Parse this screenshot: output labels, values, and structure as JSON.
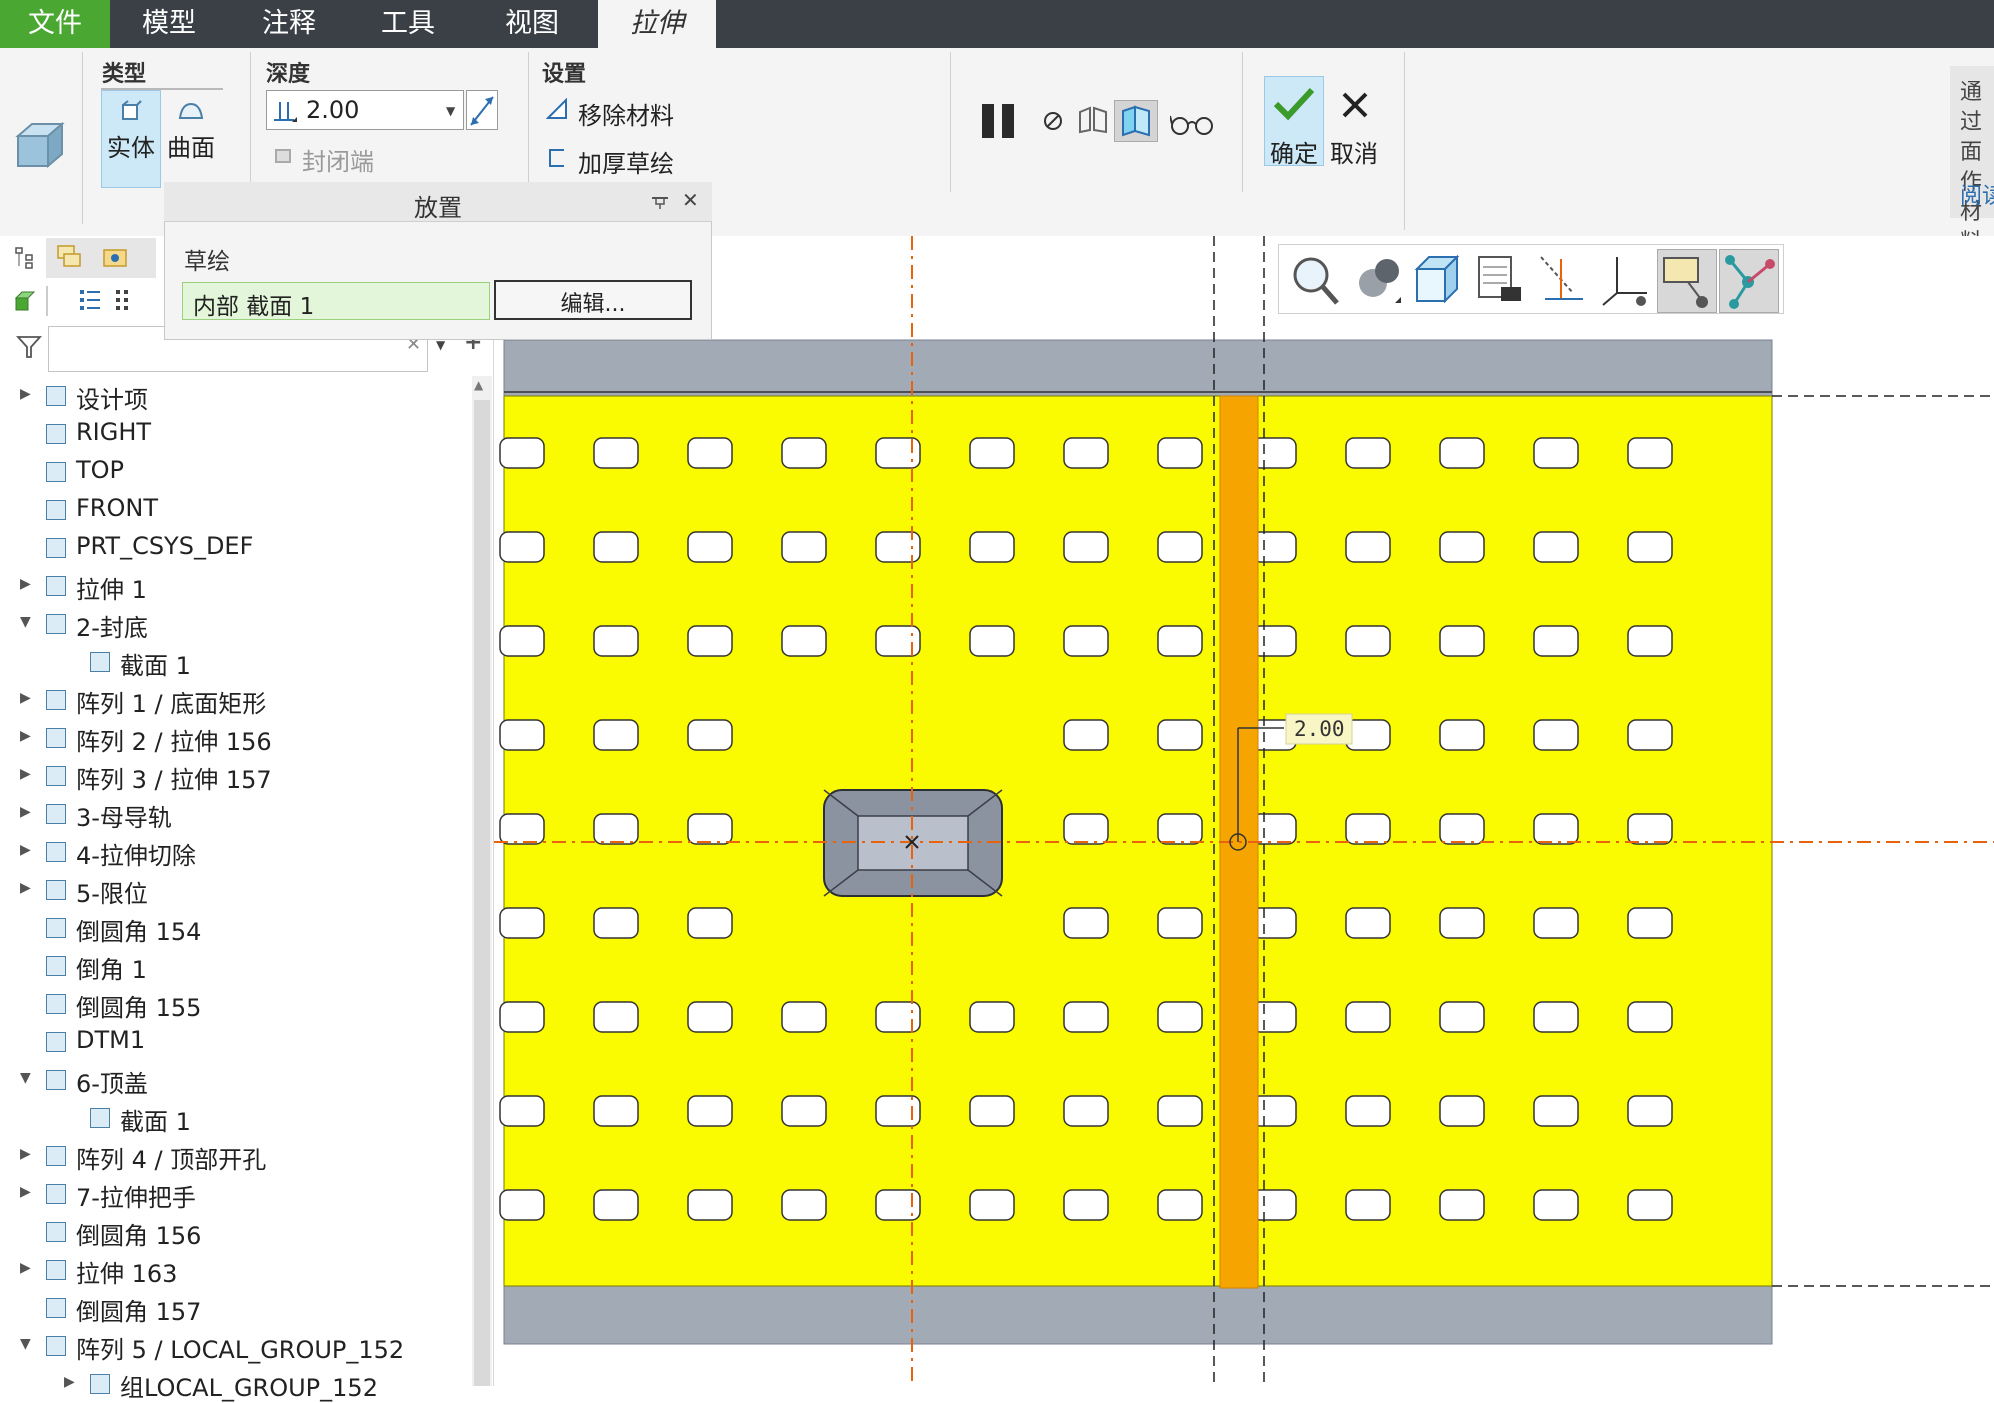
{
  "menu": {
    "tabs": [
      "文件",
      "模型",
      "注释",
      "工具",
      "视图",
      "拉伸"
    ]
  },
  "ribbon": {
    "type": {
      "title": "类型",
      "solid": "实体",
      "surface": "曲面"
    },
    "depth": {
      "title": "深度",
      "value": "2.00",
      "cap_ends": "封闭端"
    },
    "settings": {
      "title": "设置",
      "remove_material": "移除材料",
      "thicken_sketch": "加厚草绘"
    },
    "confirm": "确定",
    "cancel": "取消",
    "help_text": [
      "通过",
      "面作",
      "材料"
    ],
    "help_link": "阅读"
  },
  "placement": {
    "title": "放置",
    "sketch_label": "草绘",
    "section_value": "内部 截面 1",
    "edit_button": "编辑..."
  },
  "tree": {
    "items": [
      {
        "label": "设计项",
        "indent": 0,
        "expander": "▶"
      },
      {
        "label": "RIGHT",
        "indent": 0,
        "expander": ""
      },
      {
        "label": "TOP",
        "indent": 0,
        "expander": ""
      },
      {
        "label": "FRONT",
        "indent": 0,
        "expander": ""
      },
      {
        "label": "PRT_CSYS_DEF",
        "indent": 0,
        "expander": ""
      },
      {
        "label": "拉伸 1",
        "indent": 0,
        "expander": "▶"
      },
      {
        "label": "2-封底",
        "indent": 0,
        "expander": "▼"
      },
      {
        "label": "截面 1",
        "indent": 1,
        "expander": ""
      },
      {
        "label": "阵列 1 / 底面矩形",
        "indent": 0,
        "expander": "▶"
      },
      {
        "label": "阵列 2 / 拉伸 156",
        "indent": 0,
        "expander": "▶"
      },
      {
        "label": "阵列 3 / 拉伸 157",
        "indent": 0,
        "expander": "▶"
      },
      {
        "label": "3-母导轨",
        "indent": 0,
        "expander": "▶"
      },
      {
        "label": "4-拉伸切除",
        "indent": 0,
        "expander": "▶"
      },
      {
        "label": "5-限位",
        "indent": 0,
        "expander": "▶"
      },
      {
        "label": "倒圆角 154",
        "indent": 0,
        "expander": ""
      },
      {
        "label": "倒角 1",
        "indent": 0,
        "expander": ""
      },
      {
        "label": "倒圆角 155",
        "indent": 0,
        "expander": ""
      },
      {
        "label": "DTM1",
        "indent": 0,
        "expander": ""
      },
      {
        "label": "6-顶盖",
        "indent": 0,
        "expander": "▼"
      },
      {
        "label": "截面 1",
        "indent": 1,
        "expander": ""
      },
      {
        "label": "阵列 4 / 顶部开孔",
        "indent": 0,
        "expander": "▶"
      },
      {
        "label": "7-拉伸把手",
        "indent": 0,
        "expander": "▶"
      },
      {
        "label": "倒圆角 156",
        "indent": 0,
        "expander": ""
      },
      {
        "label": "拉伸 163",
        "indent": 0,
        "expander": "▶"
      },
      {
        "label": "倒圆角 157",
        "indent": 0,
        "expander": ""
      },
      {
        "label": "阵列 5 / LOCAL_GROUP_152",
        "indent": 0,
        "expander": "▼"
      },
      {
        "label": "组LOCAL_GROUP_152",
        "indent": 1,
        "expander": "▶"
      }
    ]
  },
  "graphics": {
    "dimension": "2.00"
  },
  "colors": {
    "accent": "#4aa832",
    "menubar": "#3b4047",
    "part_face": "#fafa00",
    "part_edge": "#a2aab6",
    "preview": "#f5a400",
    "datum_line": "#e8630a"
  }
}
